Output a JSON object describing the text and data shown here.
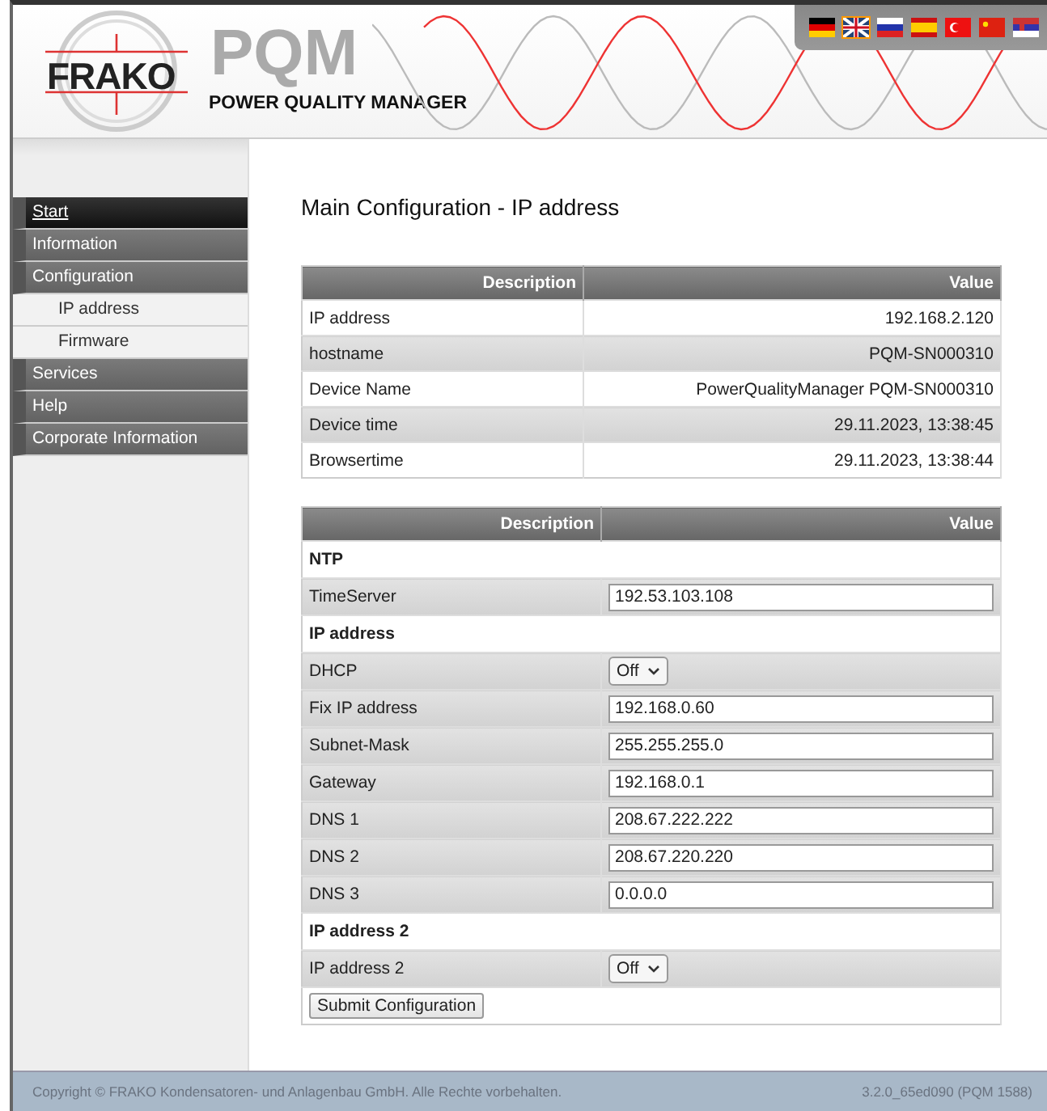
{
  "header": {
    "logo_text": "FRAKO",
    "product": "PQM",
    "tagline": "POWER QUALITY MANAGER",
    "languages": [
      {
        "kind": "de",
        "selected": false
      },
      {
        "kind": "gb",
        "selected": true
      },
      {
        "kind": "ru",
        "selected": false
      },
      {
        "kind": "es",
        "selected": false
      },
      {
        "kind": "tr",
        "selected": false
      },
      {
        "kind": "cn",
        "selected": false
      },
      {
        "kind": "rs",
        "selected": false
      }
    ]
  },
  "sidebar": {
    "items": [
      {
        "label": "Start",
        "kind": "top",
        "selected": true
      },
      {
        "label": "Information",
        "kind": "top",
        "selected": false
      },
      {
        "label": "Configuration",
        "kind": "top",
        "selected": false
      },
      {
        "label": "IP address",
        "kind": "sub",
        "selected": false
      },
      {
        "label": "Firmware",
        "kind": "sub",
        "selected": false
      },
      {
        "label": "Services",
        "kind": "top",
        "selected": false
      },
      {
        "label": "Help",
        "kind": "top",
        "selected": false
      },
      {
        "label": "Corporate Information",
        "kind": "top",
        "selected": false
      }
    ]
  },
  "page_title": "Main Configuration - IP address",
  "info_table": {
    "columns": [
      "Description",
      "Value"
    ],
    "rows": [
      [
        "IP address",
        "192.168.2.120"
      ],
      [
        "hostname",
        "PQM-SN000310"
      ],
      [
        "Device Name",
        "PowerQualityManager PQM-SN000310"
      ],
      [
        "Device time",
        "29.11.2023, 13:38:45"
      ],
      [
        "Browsertime",
        "29.11.2023, 13:38:44"
      ]
    ]
  },
  "config_table": {
    "columns": [
      "Description",
      "Value"
    ],
    "rows": [
      {
        "kind": "section",
        "label": "NTP"
      },
      {
        "kind": "text",
        "label": "TimeServer",
        "value": "192.53.103.108"
      },
      {
        "kind": "section",
        "label": "IP address"
      },
      {
        "kind": "select",
        "label": "DHCP",
        "value": "Off"
      },
      {
        "kind": "text",
        "label": "Fix IP address",
        "value": "192.168.0.60"
      },
      {
        "kind": "text",
        "label": "Subnet-Mask",
        "value": "255.255.255.0"
      },
      {
        "kind": "text",
        "label": "Gateway",
        "value": "192.168.0.1"
      },
      {
        "kind": "text",
        "label": "DNS 1",
        "value": "208.67.222.222"
      },
      {
        "kind": "text",
        "label": "DNS 2",
        "value": "208.67.220.220"
      },
      {
        "kind": "text",
        "label": "DNS 3",
        "value": "0.0.0.0"
      },
      {
        "kind": "section",
        "label": "IP address 2"
      },
      {
        "kind": "select",
        "label": "IP address 2",
        "value": "Off"
      },
      {
        "kind": "button",
        "label": "Submit Configuration"
      }
    ]
  },
  "footer": {
    "copyright": "Copyright © FRAKO Kondensatoren- und Anlagenbau GmbH. Alle Rechte vorbehalten.",
    "version": "3.2.0_65ed090 (PQM 1588)"
  }
}
